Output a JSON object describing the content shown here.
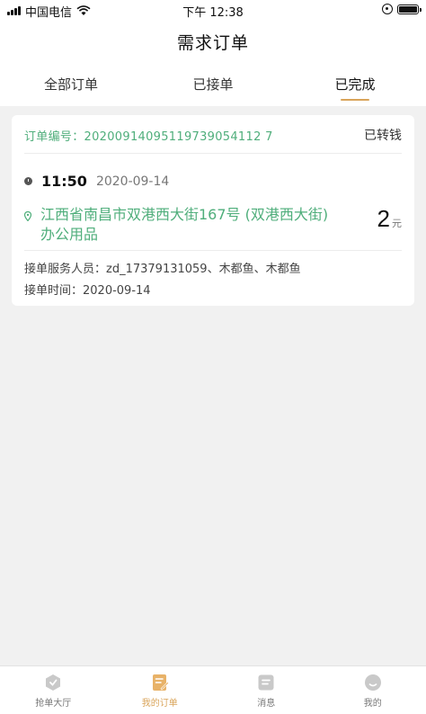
{
  "status_bar": {
    "carrier": "中国电信",
    "time": "下午 12:38"
  },
  "header": {
    "title": "需求订单"
  },
  "tabs": [
    {
      "label": "全部订单",
      "active": false
    },
    {
      "label": "已接单",
      "active": false
    },
    {
      "label": "已完成",
      "active": true
    }
  ],
  "order": {
    "number_label": "订单编号：",
    "number": "20200914095119739054112 7",
    "status": "已转钱",
    "time": "11:50",
    "date": "2020-09-14",
    "address": "江西省南昌市双港西大街167号 (双港西大街) 办公用品",
    "price": "2",
    "price_unit": "元",
    "staff_label": "接单服务人员：",
    "staff": "zd_17379131059、木都鱼、木都鱼",
    "accept_time_label": "接单时间：",
    "accept_time": "2020-09-14"
  },
  "bottom_nav": [
    {
      "label": "抢单大厅",
      "icon": "hall-icon",
      "active": false
    },
    {
      "label": "我的订单",
      "icon": "order-icon",
      "active": true
    },
    {
      "label": "消息",
      "icon": "message-icon",
      "active": false
    },
    {
      "label": "我的",
      "icon": "profile-icon",
      "active": false
    }
  ],
  "colors": {
    "accent": "#d9a45a",
    "green": "#4fae7b"
  }
}
